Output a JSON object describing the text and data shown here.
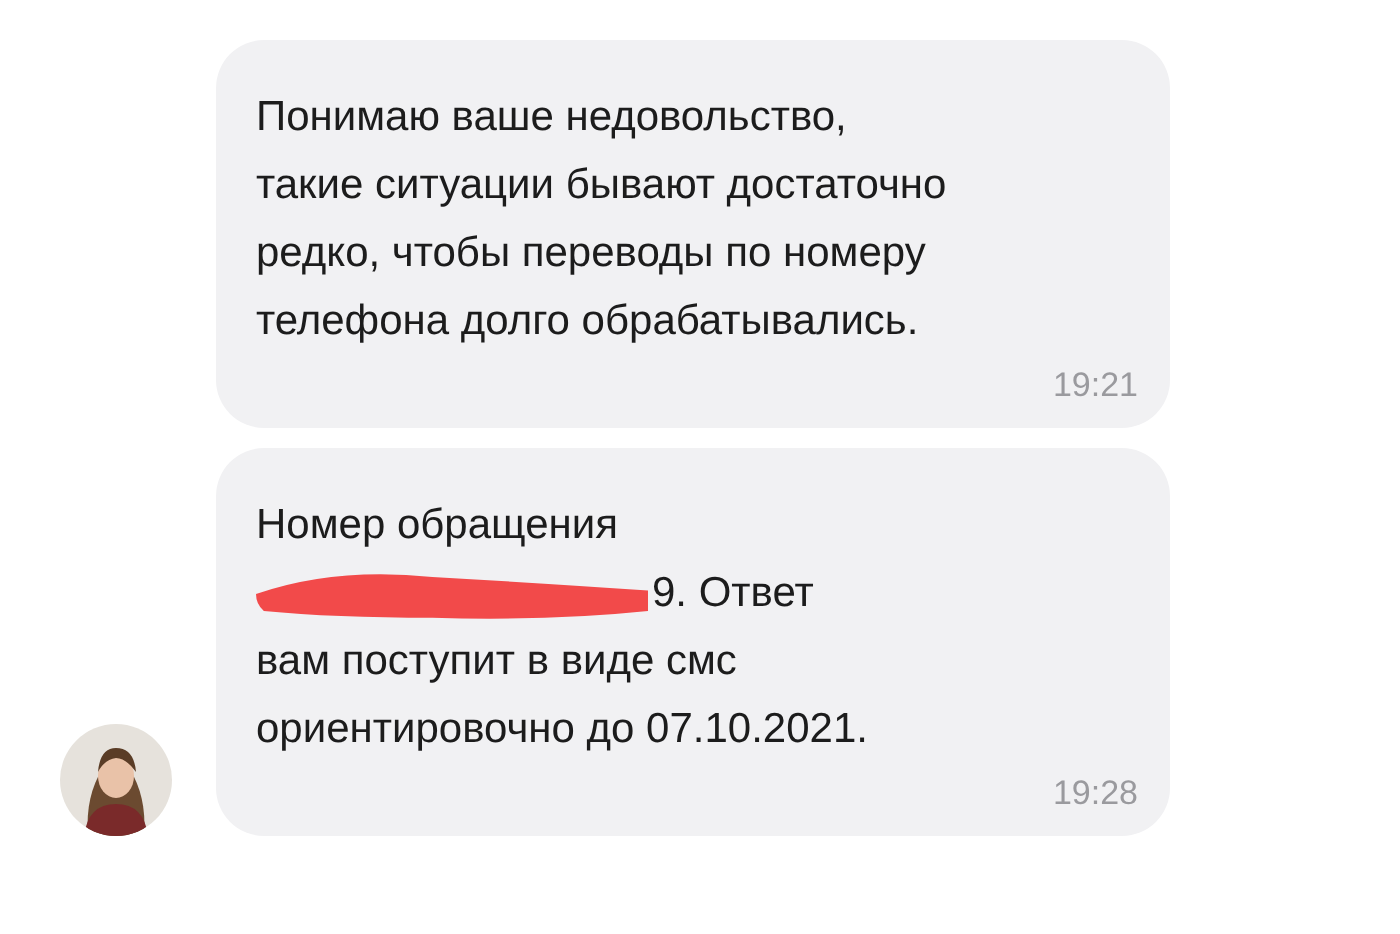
{
  "messages": [
    {
      "segments": [
        {
          "kind": "text",
          "text": "Понимаю ваше недовольство,\nтакие ситуации бывают достаточно\nредко, чтобы переводы по номеру\nтелефона долго обрабатывались."
        }
      ],
      "time": "19:21",
      "avatar": false
    },
    {
      "segments": [
        {
          "kind": "text",
          "text": "Номер обращения"
        },
        {
          "kind": "redacted_line",
          "text": "9. Ответ"
        },
        {
          "kind": "text",
          "text": "вам поступит в виде смс\nориентировочно до 07.10.2021."
        }
      ],
      "time": "19:28",
      "avatar": true
    }
  ]
}
